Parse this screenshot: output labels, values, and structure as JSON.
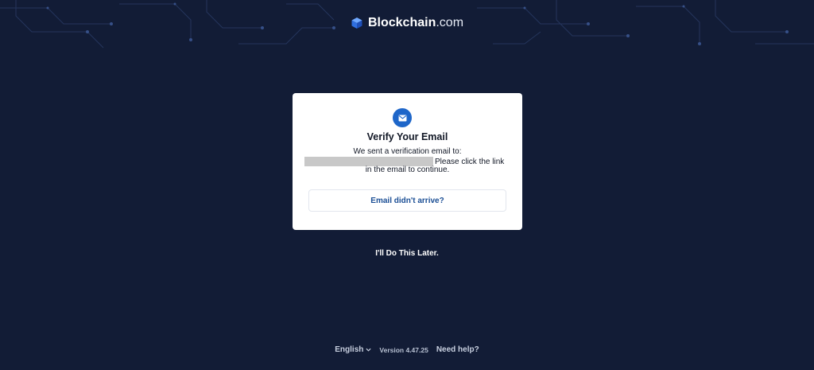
{
  "header": {
    "brand_name": "Blockchain",
    "brand_suffix": ".com",
    "logo_icon": "blockchain-cube-icon"
  },
  "verify_card": {
    "icon": "mail-icon",
    "title": "Verify Your Email",
    "line1": "We sent a verification email to:",
    "email_redacted": "",
    "line2_rest": "Please click the link",
    "line3": "in the email to continue.",
    "resend_label": "Email didn't arrive?"
  },
  "later_label": "I'll Do This Later.",
  "footer": {
    "language": "English",
    "language_icon": "chevron-down-icon",
    "version": "Version 4.47.25",
    "help_label": "Need help?"
  },
  "colors": {
    "background": "#121c36",
    "card": "#ffffff",
    "accent_blue": "#1e66c9",
    "link_blue": "#1c4f95"
  }
}
